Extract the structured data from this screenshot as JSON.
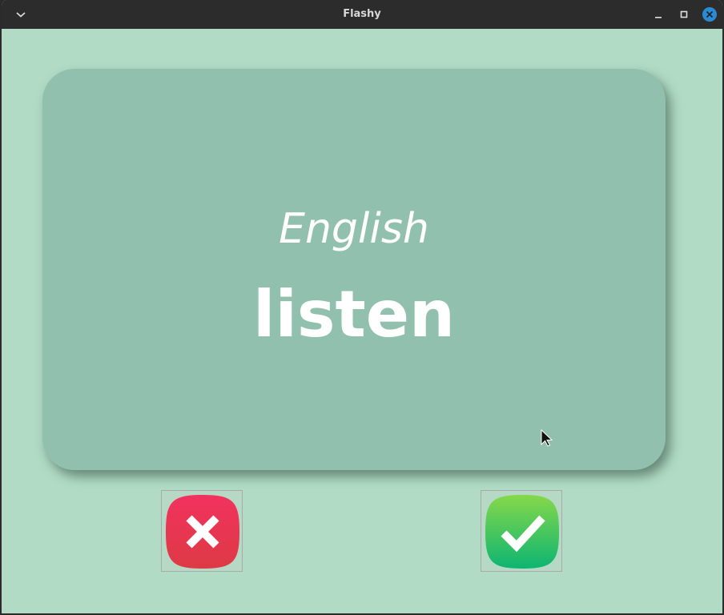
{
  "window": {
    "title": "Flashy",
    "icons": {
      "menu": "chevron-down-icon",
      "minimize": "minimize-icon",
      "maximize": "maximize-icon",
      "close": "close-icon"
    }
  },
  "card": {
    "language": "English",
    "word": "listen",
    "color": "#91c1ae"
  },
  "buttons": {
    "wrong": {
      "icon": "cross-icon",
      "color": "#e8344e"
    },
    "right": {
      "icon": "checkmark-icon",
      "color": "#2dc45a"
    }
  },
  "colors": {
    "background": "#b1dbc5",
    "titlebar": "#2c2c2c",
    "close_accent": "#2a8bd4"
  }
}
